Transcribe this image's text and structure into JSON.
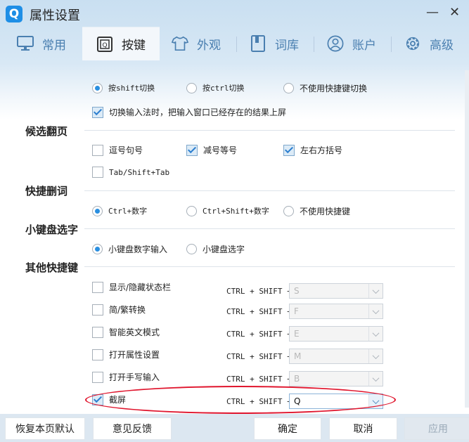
{
  "window": {
    "title": "属性设置",
    "logo": "Q",
    "minimize_label": "—",
    "close_label": "✕"
  },
  "tabs": [
    {
      "label": "常用",
      "icon": "monitor-icon",
      "active": false
    },
    {
      "label": "按键",
      "icon": "key-q-icon",
      "active": true
    },
    {
      "label": "外观",
      "icon": "shirt-icon",
      "active": false
    },
    {
      "label": "词库",
      "icon": "book-icon",
      "active": false
    },
    {
      "label": "账户",
      "icon": "user-icon",
      "active": false
    },
    {
      "label": "高级",
      "icon": "gear-icon",
      "active": false
    }
  ],
  "switch": {
    "options": [
      "按shift切换",
      "按ctrl切换",
      "不使用快捷键切换"
    ],
    "selected": 0,
    "commit_label": "切换输入法时，把输入窗口已经存在的结果上屏",
    "commit_checked": true
  },
  "paging": {
    "title": "候选翻页",
    "options": [
      {
        "label": "逗号句号",
        "checked": false
      },
      {
        "label": "减号等号",
        "checked": true
      },
      {
        "label": "左右方括号",
        "checked": true
      },
      {
        "label": "Tab/Shift+Tab",
        "checked": false
      }
    ]
  },
  "delete_word": {
    "title": "快捷删词",
    "options": [
      "Ctrl+数字",
      "Ctrl+Shift+数字",
      "不使用快捷键"
    ],
    "selected": 0
  },
  "numpad": {
    "title": "小键盘选字",
    "options": [
      "小键盘数字输入",
      "小键盘选字"
    ],
    "selected": 0
  },
  "other": {
    "title": "其他快捷键",
    "prefix": "CTRL + SHIFT +",
    "items": [
      {
        "label": "显示/隐藏状态栏",
        "checked": false,
        "key": "S"
      },
      {
        "label": "简/繁转换",
        "checked": false,
        "key": "F"
      },
      {
        "label": "智能英文模式",
        "checked": false,
        "key": "E"
      },
      {
        "label": "打开属性设置",
        "checked": false,
        "key": "M"
      },
      {
        "label": "打开手写输入",
        "checked": false,
        "key": "B"
      },
      {
        "label": "截屏",
        "checked": true,
        "key": "Q"
      }
    ]
  },
  "footer": {
    "restore": "恢复本页默认",
    "feedback": "意见反馈",
    "ok": "确定",
    "cancel": "取消",
    "apply": "应用"
  },
  "colors": {
    "accent": "#2a8fe0",
    "highlight": "#e0152d",
    "tab_inactive": "#4a7fb0"
  }
}
